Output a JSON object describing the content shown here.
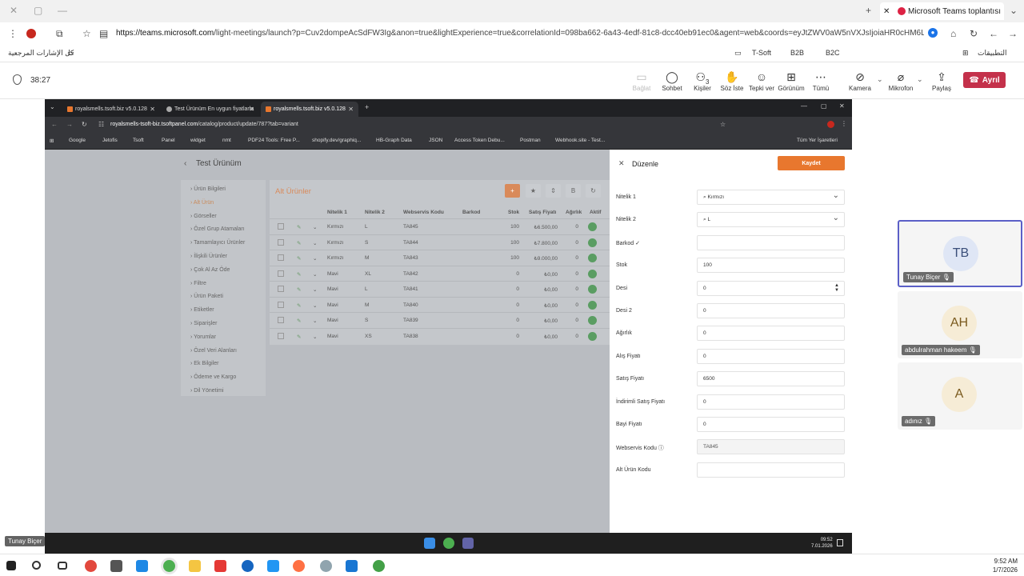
{
  "outer_browser": {
    "tab_title": "Microsoft Teams toplantısı",
    "url_host": "https://teams.microsoft.com",
    "url_rest": "/light-meetings/launch?p=Cuv2dompeAcSdFW3Ig&anon=true&lightExperience=true&correlationId=098ba662-6a43-4edf-81c8-dcc40eb91ec0&agent=web&coords=eyJtZWV0aW5nVXJsIjoiaHR0cHM6Ly90ZWFtcy5",
    "bookmarks_rtl": "كل الإشارات المرجعية",
    "bookmarks": [
      "T-Soft",
      "B2B",
      "B2C"
    ],
    "bookmarks_apps": "التطبيقات"
  },
  "teams": {
    "timer": "38:27",
    "buttons": [
      "Bağlat",
      "Sohbet",
      "Kişiler",
      "Söz İste",
      "Tepki ver",
      "Görünüm",
      "Tümü",
      "Kamera",
      "Mikrofon",
      "Paylaş"
    ],
    "people_count": "3",
    "leave": "Ayrıl"
  },
  "inner_browser": {
    "tabs": [
      "royalsmells.tsoft.biz v5.0.128",
      "Test Ürünüm En uygun fiyatlarla",
      "royalsmells.tsoft.biz v5.0.128"
    ],
    "url_host": "royalsmells-tsoft-biz.tsoftpanel.com",
    "url_rest": "/catalog/product/update/787?tab=variant",
    "bookmarks": [
      "Google",
      "Jetofis",
      "Tsoft",
      "Panel",
      "widget",
      "nmt",
      "PDF24 Tools: Free P...",
      "shopify.dev/graphiq...",
      "HB-Graph Data",
      "JSON",
      "Access Token Debu...",
      "Postman",
      "Webhook.site - Test..."
    ],
    "all_bookmarks": "Tüm Yer İşaretleri"
  },
  "page": {
    "title": "Test Ürünüm",
    "nav": [
      "Ürün Bilgileri",
      "Alt Ürün",
      "Görseller",
      "Özel Grup Atamaları",
      "Tamamlayıcı Ürünler",
      "İlişkili Ürünler",
      "Çok Al Az Öde",
      "Filtre",
      "Ürün Paketi",
      "Etiketler",
      "Siparişler",
      "Yorumlar",
      "Özel Veri Alanları",
      "Ek Bilgiler",
      "Ödeme ve Kargo",
      "Dil Yönetimi"
    ],
    "panel_title": "Alt Ürünler",
    "panel_buttons": [
      "+",
      "★",
      "⇕",
      "B",
      "↻"
    ],
    "columns": [
      "Nitelik 1",
      "Nitelik 2",
      "Webservis Kodu",
      "Barkod",
      "Stok",
      "Satış Fiyatı",
      "Ağırlık",
      "Aktif"
    ],
    "rows": [
      [
        "Kırmızı",
        "L",
        "TA845",
        "",
        "100",
        "₺6.500,00",
        "0"
      ],
      [
        "Kırmızı",
        "S",
        "TA844",
        "",
        "100",
        "₺7.800,00",
        "0"
      ],
      [
        "Kırmızı",
        "M",
        "TA843",
        "",
        "100",
        "₺9.000,00",
        "0"
      ],
      [
        "Mavi",
        "XL",
        "TA842",
        "",
        "0",
        "₺0,00",
        "0"
      ],
      [
        "Mavi",
        "L",
        "TA841",
        "",
        "0",
        "₺0,00",
        "0"
      ],
      [
        "Mavi",
        "M",
        "TA840",
        "",
        "0",
        "₺0,00",
        "0"
      ],
      [
        "Mavi",
        "S",
        "TA839",
        "",
        "0",
        "₺0,00",
        "0"
      ],
      [
        "Mavi",
        "XS",
        "TA838",
        "",
        "0",
        "₺0,00",
        "0"
      ]
    ]
  },
  "drawer": {
    "title": "Düzenle",
    "save": "Kaydet",
    "fields": [
      {
        "label": "Nitelik 1",
        "value": "⌕ Kırmızı"
      },
      {
        "label": "Nitelik 2",
        "value": "⌕ L"
      },
      {
        "label": "Barkod ✓",
        "value": ""
      },
      {
        "label": "Stok",
        "value": "100"
      },
      {
        "label": "Desi",
        "value": "0"
      },
      {
        "label": "Desi 2",
        "value": "0"
      },
      {
        "label": "Ağırlık",
        "value": "0"
      },
      {
        "label": "Alış Fiyatı",
        "value": "0"
      },
      {
        "label": "Satış Fiyatı",
        "value": "6500"
      },
      {
        "label": "İndirimli Satış Fiyatı",
        "value": "0"
      },
      {
        "label": "Bayi Fiyatı",
        "value": "0"
      },
      {
        "label": "Webservis Kodu ⓘ",
        "value": "TA845"
      },
      {
        "label": "Alt Ürün Kodu",
        "value": ""
      }
    ]
  },
  "inner_clock": {
    "time": "09:52",
    "date": "7.01.2026"
  },
  "participants": [
    {
      "initials": "TB",
      "name": "Tunay Biçer",
      "bg": "#dfe6f5",
      "fg": "#3b4f7a"
    },
    {
      "initials": "AH",
      "name": "abdulrahman hakeem",
      "bg": "#f6ecd6",
      "fg": "#7a5a1e"
    },
    {
      "initials": "A",
      "name": "adınız",
      "bg": "#f6ecd6",
      "fg": "#7a5a1e"
    }
  ],
  "presenter": "Tunay Biçer",
  "taskbar_clock": {
    "time": "9:52 AM",
    "date": "1/7/2026"
  }
}
